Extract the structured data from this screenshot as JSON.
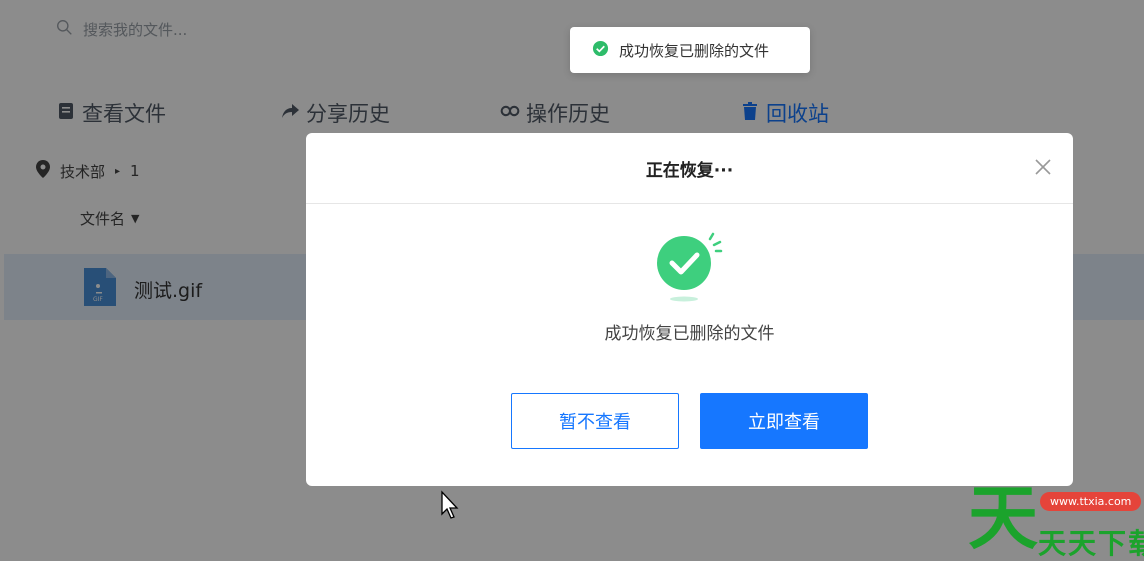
{
  "search": {
    "placeholder": "搜索我的文件..."
  },
  "nav": {
    "items": [
      {
        "label": "查看文件",
        "icon": "document-icon"
      },
      {
        "label": "分享历史",
        "icon": "share-icon"
      },
      {
        "label": "操作历史",
        "icon": "history-icon"
      },
      {
        "label": "回收站",
        "icon": "trash-icon",
        "active": true
      }
    ]
  },
  "breadcrumb": {
    "folder": "技术部",
    "count": "1"
  },
  "table": {
    "column_name": "文件名"
  },
  "files": [
    {
      "name": "测试.gif"
    }
  ],
  "toast": {
    "message": "成功恢复已删除的文件"
  },
  "modal": {
    "title": "正在恢复···",
    "message": "成功恢复已删除的文件",
    "secondary_button": "暂不查看",
    "primary_button": "立即查看"
  },
  "watermark": {
    "big": "天",
    "url": "www.ttxia.com",
    "text": "天天下载"
  },
  "colors": {
    "accent": "#1677ff",
    "success": "#3ecf7e",
    "overlay": "rgba(0,0,0,0.45)"
  }
}
